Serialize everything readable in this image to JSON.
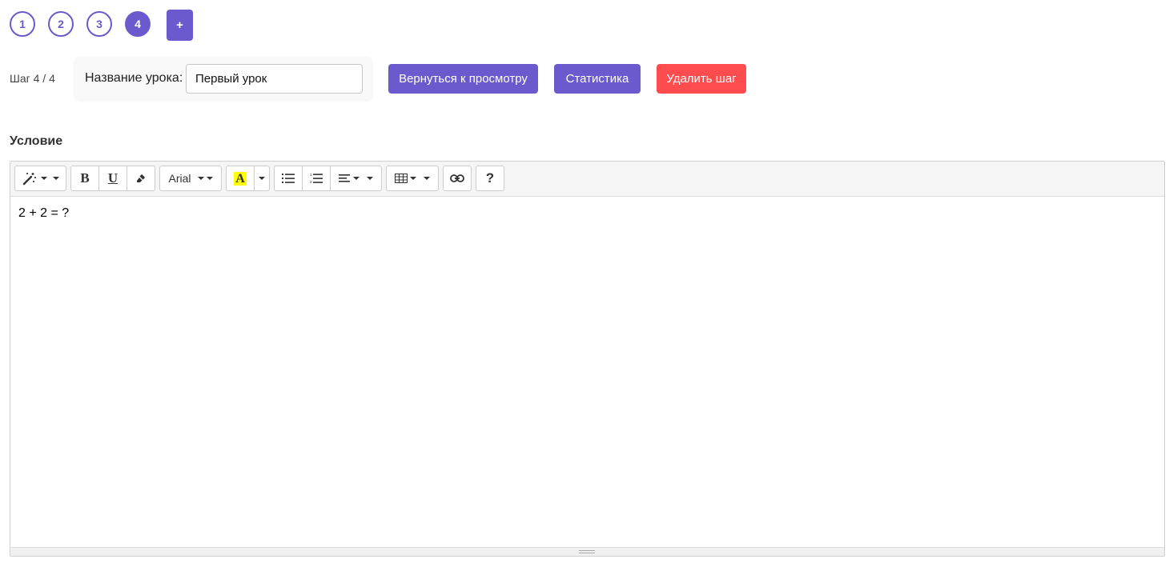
{
  "steps": {
    "items": [
      {
        "label": "1",
        "active": false
      },
      {
        "label": "2",
        "active": false
      },
      {
        "label": "3",
        "active": false
      },
      {
        "label": "4",
        "active": true
      }
    ],
    "add_label": "+"
  },
  "header": {
    "step_counter": "Шаг 4 / 4",
    "lesson_title_label": "Название урока:",
    "lesson_title_value": "Первый урок",
    "back_button": "Вернуться к просмотру",
    "stats_button": "Статистика",
    "delete_button": "Удалить шаг"
  },
  "condition": {
    "label": "Условие"
  },
  "editor": {
    "toolbar": {
      "style_icon": "magic-wand-icon",
      "bold": "B",
      "underline": "U",
      "eraser_icon": "eraser-icon",
      "font_name": "Arial",
      "color_letter": "A",
      "unordered_list_icon": "bullet-list-icon",
      "ordered_list_icon": "numbered-list-icon",
      "align_icon": "align-left-icon",
      "table_icon": "table-icon",
      "link_icon": "link-icon",
      "help": "?"
    },
    "content": "2 + 2 = ?"
  },
  "colors": {
    "accent": "#6a5acd",
    "danger": "#ff4d4f",
    "highlight": "#ffff00"
  }
}
